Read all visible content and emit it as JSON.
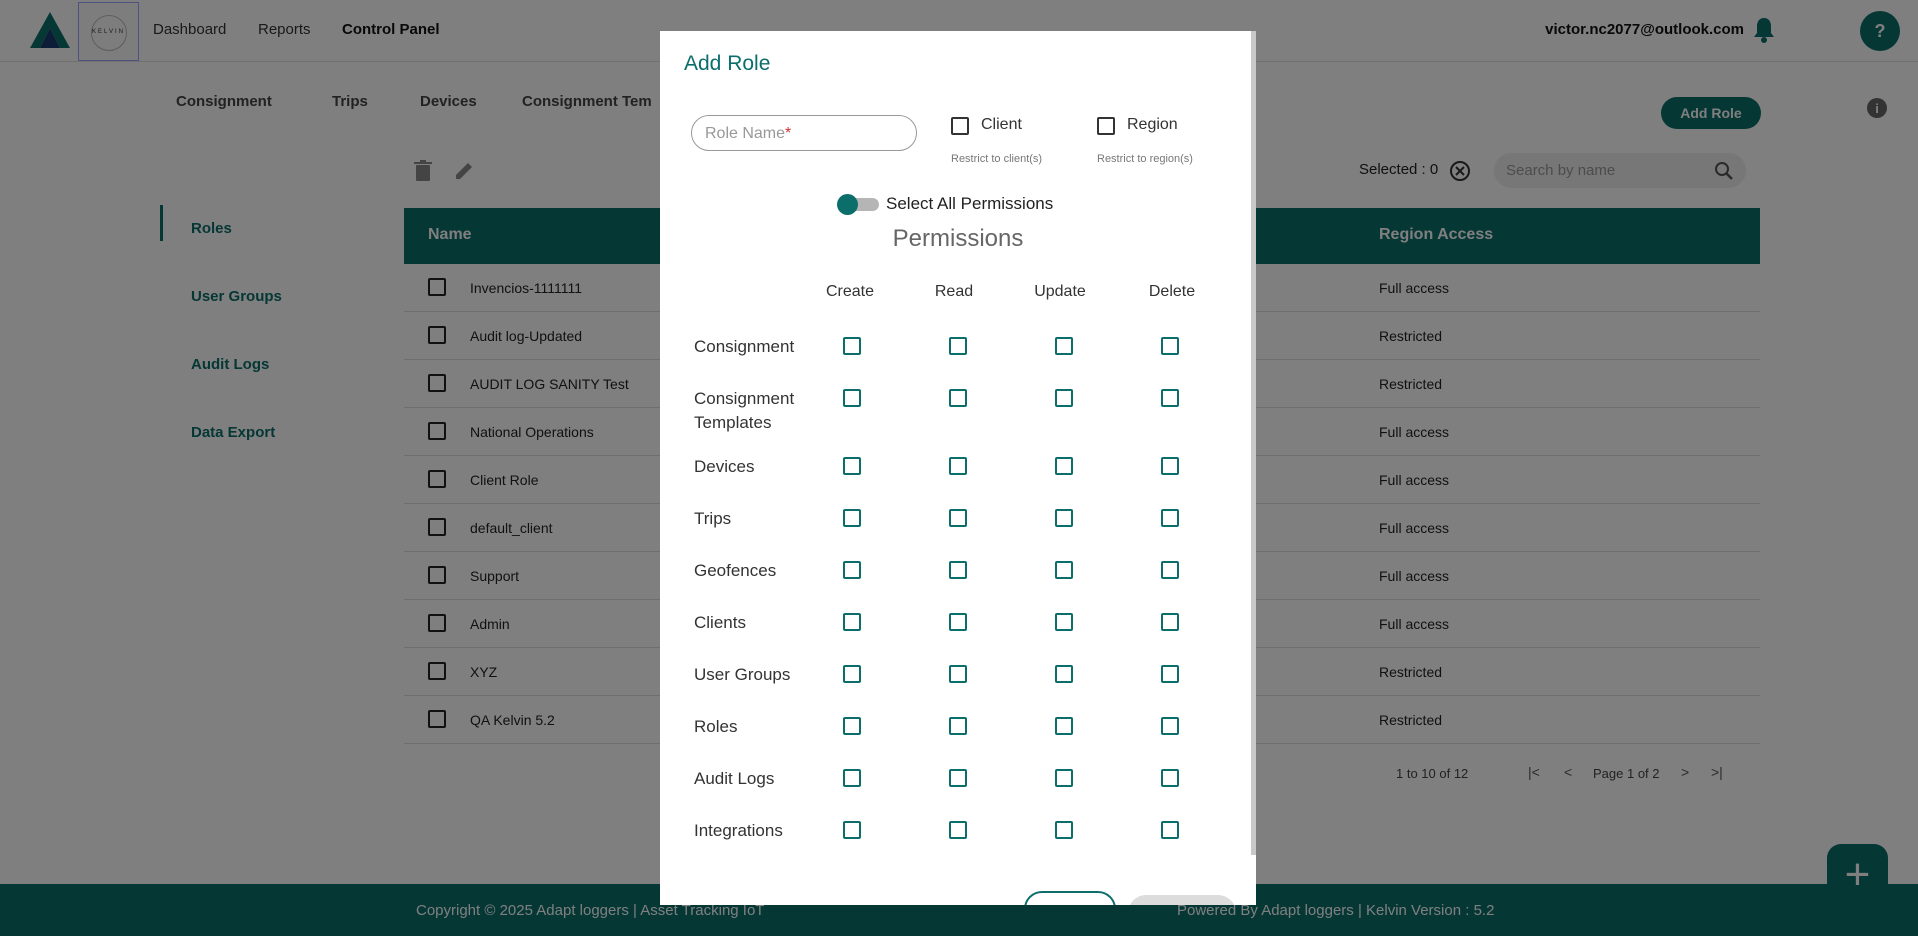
{
  "header": {
    "logo_text": "KELVIN",
    "nav": [
      "Dashboard",
      "Reports",
      "Control Panel"
    ],
    "user_email": "victor.nc2077@outlook.com",
    "help_label": "?"
  },
  "subtabs": [
    "Consignment",
    "Trips",
    "Devices",
    "Consignment Tem"
  ],
  "toolbar": {
    "add_role_label": "Add Role",
    "info_label": "i",
    "selected_text": "Selected : 0",
    "search_placeholder": "Search by name"
  },
  "sidebar": [
    "Roles",
    "User Groups",
    "Audit Logs",
    "Data Export"
  ],
  "table": {
    "headers": {
      "name": "Name",
      "region": "Region Access"
    },
    "rows": [
      {
        "name": "Invencios-1111111",
        "access": "Full access"
      },
      {
        "name": "Audit log-Updated",
        "access": "Restricted"
      },
      {
        "name": "AUDIT LOG SANITY Test",
        "access": "Restricted"
      },
      {
        "name": "National Operations",
        "access": "Full access"
      },
      {
        "name": "Client Role",
        "access": "Full access"
      },
      {
        "name": "default_client",
        "access": "Full access"
      },
      {
        "name": "Support",
        "access": "Full access"
      },
      {
        "name": "Admin",
        "access": "Full access"
      },
      {
        "name": "XYZ",
        "access": "Restricted"
      },
      {
        "name": "QA Kelvin 5.2",
        "access": "Restricted"
      }
    ]
  },
  "pagination": {
    "range": "1 to 10 of 12",
    "page": "Page 1 of 2",
    "first": "|<",
    "prev": "<",
    "next": ">",
    "last": ">|"
  },
  "footer": {
    "left": "Copyright © 2025 Adapt loggers | Asset Tracking IoT",
    "right": "Powered By Adapt loggers | Kelvin Version : 5.2"
  },
  "fab_label": "+",
  "modal": {
    "title": "Add Role",
    "role_name_placeholder": "Role Name",
    "required_mark": "*",
    "client_label": "Client",
    "client_sub": "Restrict to client(s)",
    "region_label": "Region",
    "region_sub": "Restrict to region(s)",
    "select_all_label": "Select All Permissions",
    "permissions_title": "Permissions",
    "columns": [
      "Create",
      "Read",
      "Update",
      "Delete"
    ],
    "permissions": [
      "Consignment",
      "Consignment Templates",
      "Devices",
      "Trips",
      "Geofences",
      "Clients",
      "User Groups",
      "Roles",
      "Audit Logs",
      "Integrations"
    ]
  },
  "colors": {
    "primary": "#0b6e6b",
    "overlay": "rgba(0,0,0,0.5)"
  }
}
